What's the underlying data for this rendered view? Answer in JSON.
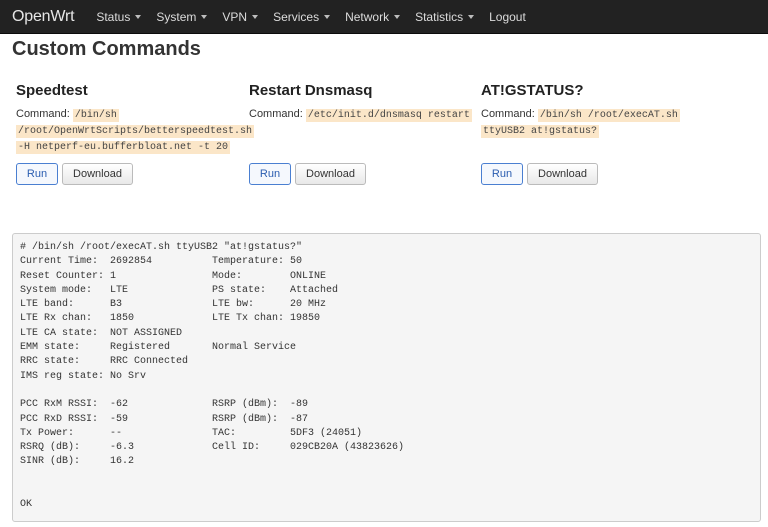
{
  "nav": {
    "brand": "OpenWrt",
    "items": [
      "Status",
      "System",
      "VPN",
      "Services",
      "Network",
      "Statistics"
    ],
    "logout": "Logout"
  },
  "page": {
    "title": "Custom Commands"
  },
  "commands": [
    {
      "title": "Speedtest",
      "label": "Command:",
      "code_lines": [
        "/bin/sh",
        "/root/OpenWrtScripts/betterspeedtest.sh",
        "-H netperf-eu.bufferbloat.net -t 20"
      ],
      "run": "Run",
      "download": "Download"
    },
    {
      "title": "Restart Dnsmasq",
      "label": "Command:",
      "code_lines": [
        "/etc/init.d/dnsmasq restart"
      ],
      "run": "Run",
      "download": "Download"
    },
    {
      "title": "AT!GSTATUS?",
      "label": "Command:",
      "code_lines": [
        "/bin/sh /root/execAT.sh",
        "ttyUSB2 at!gstatus?"
      ],
      "run": "Run",
      "download": "Download"
    }
  ],
  "output": {
    "text": "# /bin/sh /root/execAT.sh ttyUSB2 \"at!gstatus?\"\nCurrent Time:  2692854          Temperature: 50\nReset Counter: 1                Mode:        ONLINE\nSystem mode:   LTE              PS state:    Attached\nLTE band:      B3               LTE bw:      20 MHz\nLTE Rx chan:   1850             LTE Tx chan: 19850\nLTE CA state:  NOT ASSIGNED\nEMM state:     Registered       Normal Service\nRRC state:     RRC Connected\nIMS reg state: No Srv\n\nPCC RxM RSSI:  -62              RSRP (dBm):  -89\nPCC RxD RSSI:  -59              RSRP (dBm):  -87\nTx Power:      --               TAC:         5DF3 (24051)\nRSRQ (dB):     -6.3             Cell ID:     029CB20A (43823626)\nSINR (dB):     16.2\n\n\nOK"
  },
  "colors": {
    "navbar": "#222222",
    "code_bg": "#fbe6c8",
    "run_border": "#4a7fd1"
  }
}
